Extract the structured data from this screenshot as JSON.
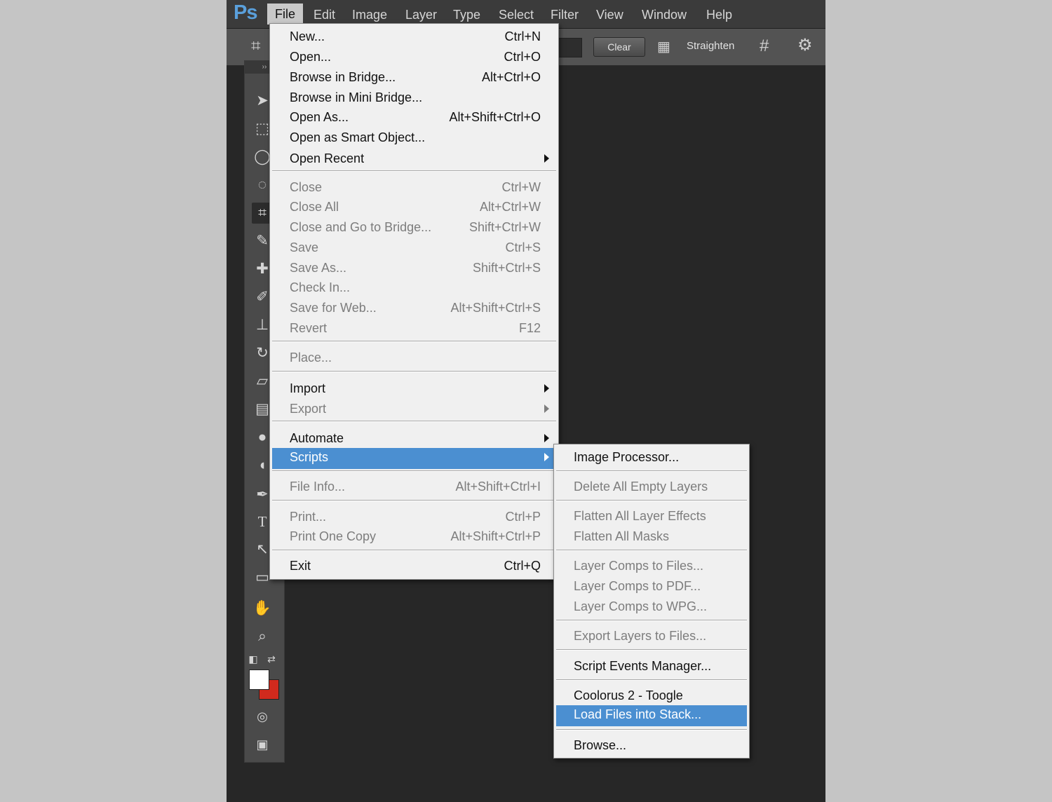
{
  "app": {
    "logo": "Ps"
  },
  "menubar": {
    "items": [
      "File",
      "Edit",
      "Image",
      "Layer",
      "Type",
      "Select",
      "Filter",
      "View",
      "Window",
      "Help"
    ],
    "active": "File"
  },
  "options_bar": {
    "clear_label": "Clear",
    "straighten_label": "Straighten",
    "icons": [
      "crop-tool-icon",
      "straighten-icon",
      "grid-overlay-icon",
      "settings-gear-icon"
    ]
  },
  "toolbar": {
    "tools": [
      "move",
      "marquee",
      "lasso",
      "quick-selection",
      "crop",
      "eyedropper",
      "spot-healing",
      "brush",
      "clone-stamp",
      "history-brush",
      "eraser",
      "gradient",
      "blur",
      "dodge",
      "pen",
      "type",
      "path-selection",
      "rectangle",
      "hand",
      "zoom"
    ],
    "active_tool": "crop",
    "foreground_color": "#ffffff",
    "background_color": "#d12a1d"
  },
  "file_menu": {
    "items": [
      {
        "label": "New...",
        "shortcut": "Ctrl+N",
        "enabled": true
      },
      {
        "label": "Open...",
        "shortcut": "Ctrl+O",
        "enabled": true
      },
      {
        "label": "Browse in Bridge...",
        "shortcut": "Alt+Ctrl+O",
        "enabled": true
      },
      {
        "label": "Browse in Mini Bridge...",
        "shortcut": "",
        "enabled": true
      },
      {
        "label": "Open As...",
        "shortcut": "Alt+Shift+Ctrl+O",
        "enabled": true
      },
      {
        "label": "Open as Smart Object...",
        "shortcut": "",
        "enabled": true
      },
      {
        "label": "Open Recent",
        "shortcut": "",
        "enabled": true,
        "submenu": true
      },
      {
        "label": "Close",
        "shortcut": "Ctrl+W",
        "enabled": false
      },
      {
        "label": "Close All",
        "shortcut": "Alt+Ctrl+W",
        "enabled": false
      },
      {
        "label": "Close and Go to Bridge...",
        "shortcut": "Shift+Ctrl+W",
        "enabled": false
      },
      {
        "label": "Save",
        "shortcut": "Ctrl+S",
        "enabled": false
      },
      {
        "label": "Save As...",
        "shortcut": "Shift+Ctrl+S",
        "enabled": false
      },
      {
        "label": "Check In...",
        "shortcut": "",
        "enabled": false
      },
      {
        "label": "Save for Web...",
        "shortcut": "Alt+Shift+Ctrl+S",
        "enabled": false
      },
      {
        "label": "Revert",
        "shortcut": "F12",
        "enabled": false
      },
      {
        "label": "Place...",
        "shortcut": "",
        "enabled": false
      },
      {
        "label": "Import",
        "shortcut": "",
        "enabled": true,
        "submenu": true
      },
      {
        "label": "Export",
        "shortcut": "",
        "enabled": false,
        "submenu": true
      },
      {
        "label": "Automate",
        "shortcut": "",
        "enabled": true,
        "submenu": true
      },
      {
        "label": "Scripts",
        "shortcut": "",
        "enabled": true,
        "submenu": true,
        "highlighted": true
      },
      {
        "label": "File Info...",
        "shortcut": "Alt+Shift+Ctrl+I",
        "enabled": false
      },
      {
        "label": "Print...",
        "shortcut": "Ctrl+P",
        "enabled": false
      },
      {
        "label": "Print One Copy",
        "shortcut": "Alt+Shift+Ctrl+P",
        "enabled": false
      },
      {
        "label": "Exit",
        "shortcut": "Ctrl+Q",
        "enabled": true
      }
    ]
  },
  "scripts_menu": {
    "items": [
      {
        "label": "Image Processor...",
        "enabled": true
      },
      {
        "label": "Delete All Empty Layers",
        "enabled": false
      },
      {
        "label": "Flatten All Layer Effects",
        "enabled": false
      },
      {
        "label": "Flatten All Masks",
        "enabled": false
      },
      {
        "label": "Layer Comps to Files...",
        "enabled": false
      },
      {
        "label": "Layer Comps to PDF...",
        "enabled": false
      },
      {
        "label": "Layer Comps to WPG...",
        "enabled": false
      },
      {
        "label": "Export Layers to Files...",
        "enabled": false
      },
      {
        "label": "Script Events Manager...",
        "enabled": true
      },
      {
        "label": "Coolorus 2 - Toogle",
        "enabled": true
      },
      {
        "label": "Load Files into Stack...",
        "enabled": true,
        "highlighted": true
      },
      {
        "label": "Browse...",
        "enabled": true
      }
    ]
  }
}
